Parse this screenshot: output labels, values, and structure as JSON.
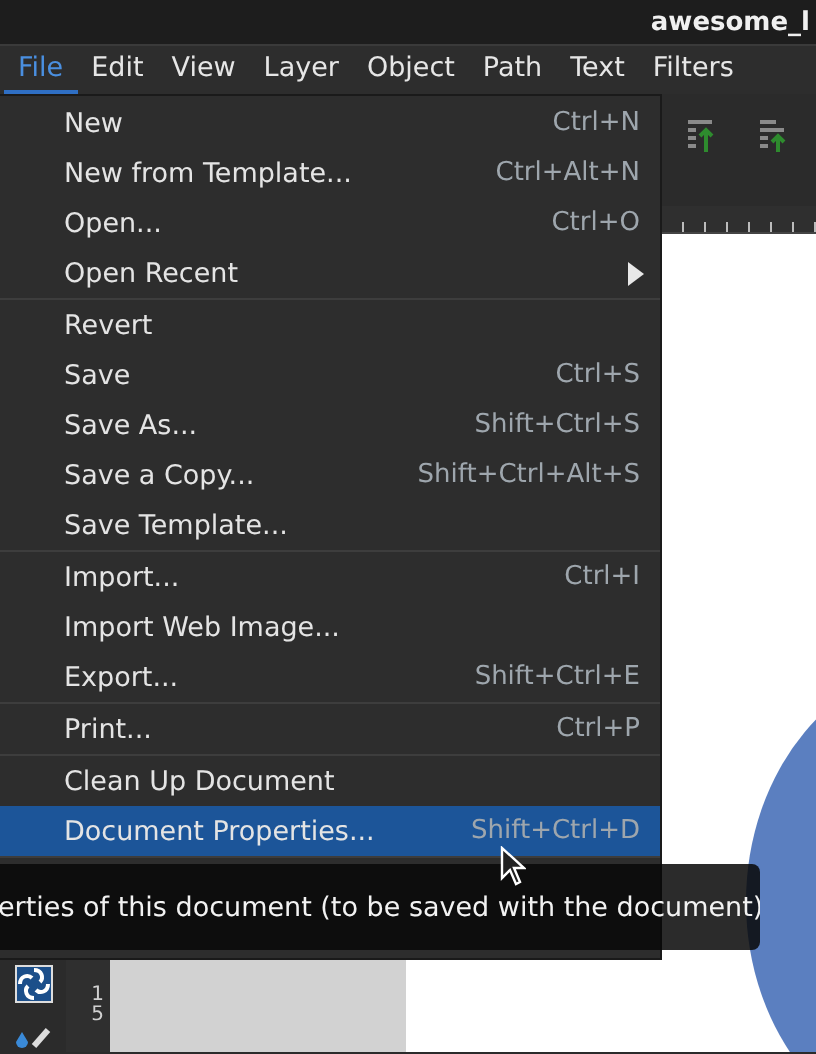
{
  "window": {
    "title": "awesome_l"
  },
  "menubar": [
    {
      "label": "File",
      "selected": true
    },
    {
      "label": "Edit",
      "selected": false
    },
    {
      "label": "View",
      "selected": false
    },
    {
      "label": "Layer",
      "selected": false
    },
    {
      "label": "Object",
      "selected": false
    },
    {
      "label": "Path",
      "selected": false
    },
    {
      "label": "Text",
      "selected": false
    },
    {
      "label": "Filters",
      "selected": false
    }
  ],
  "file_menu": {
    "sections": [
      [
        {
          "label": "New",
          "shortcut": "Ctrl+N",
          "submenu": false,
          "selected": false
        },
        {
          "label": "New from Template...",
          "shortcut": "Ctrl+Alt+N",
          "submenu": false,
          "selected": false
        },
        {
          "label": "Open...",
          "shortcut": "Ctrl+O",
          "submenu": false,
          "selected": false
        },
        {
          "label": "Open Recent",
          "submenu": true,
          "selected": false
        }
      ],
      [
        {
          "label": "Revert",
          "submenu": false,
          "selected": false
        },
        {
          "label": "Save",
          "shortcut": "Ctrl+S",
          "submenu": false,
          "selected": false
        },
        {
          "label": "Save As...",
          "shortcut": "Shift+Ctrl+S",
          "submenu": false,
          "selected": false
        },
        {
          "label": "Save a Copy...",
          "shortcut": "Shift+Ctrl+Alt+S",
          "submenu": false,
          "selected": false
        },
        {
          "label": "Save Template...",
          "submenu": false,
          "selected": false
        }
      ],
      [
        {
          "label": "Import...",
          "shortcut": "Ctrl+I",
          "submenu": false,
          "selected": false
        },
        {
          "label": "Import Web Image...",
          "submenu": false,
          "selected": false
        },
        {
          "label": "Export...",
          "shortcut": "Shift+Ctrl+E",
          "submenu": false,
          "selected": false
        }
      ],
      [
        {
          "label": "Print...",
          "shortcut": "Ctrl+P",
          "submenu": false,
          "selected": false
        }
      ],
      [
        {
          "label": "Clean Up Document",
          "submenu": false,
          "selected": false
        },
        {
          "label": "Document Properties...",
          "shortcut": "Shift+Ctrl+D",
          "submenu": false,
          "selected": true
        }
      ]
    ]
  },
  "tooltip": {
    "text": "erties of this document (to be saved with the document)"
  },
  "vertical_ruler": {
    "labels": [
      "1",
      "5"
    ]
  }
}
